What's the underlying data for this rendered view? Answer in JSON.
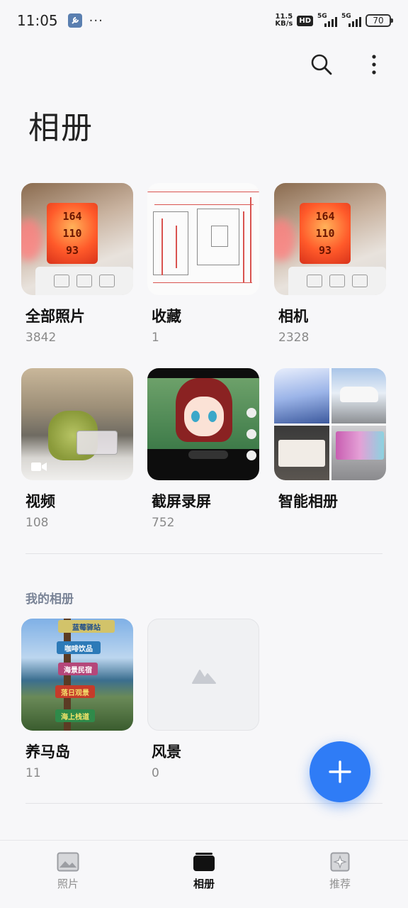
{
  "status_bar": {
    "time": "11:05",
    "more": "···",
    "speed_value": "11.5",
    "speed_unit": "KB/s",
    "hd": "HD",
    "network_1": "5G",
    "network_2": "5G",
    "battery": "70"
  },
  "header": {
    "title": "相册",
    "search_icon": "search-icon",
    "more_icon": "more-vertical-icon"
  },
  "albums": [
    {
      "name": "全部照片",
      "count": "3842",
      "display": [
        "164",
        "110",
        "93"
      ]
    },
    {
      "name": "收藏",
      "count": "1"
    },
    {
      "name": "相机",
      "count": "2328",
      "display": [
        "164",
        "110",
        "93"
      ]
    },
    {
      "name": "视频",
      "count": "108"
    },
    {
      "name": "截屏录屏",
      "count": "752"
    },
    {
      "name": "智能相册",
      "count": ""
    }
  ],
  "my_albums": {
    "section_title": "我的相册",
    "items": [
      {
        "name": "养马岛",
        "count": "11",
        "signs": [
          "蓝莓驿站",
          "咖啡饮品",
          "海景民宿",
          "落日观景",
          "海上栈道"
        ]
      },
      {
        "name": "风景",
        "count": "0"
      }
    ]
  },
  "fab": {
    "icon": "plus-icon"
  },
  "bottom_nav": {
    "items": [
      {
        "label": "照片",
        "icon": "photo-icon",
        "active": false
      },
      {
        "label": "相册",
        "icon": "album-icon",
        "active": true
      },
      {
        "label": "推荐",
        "icon": "sparkle-icon",
        "active": false
      }
    ]
  },
  "colors": {
    "accent": "#2f7cf6",
    "background": "#f7f7f9",
    "section_title": "#7a8497"
  }
}
